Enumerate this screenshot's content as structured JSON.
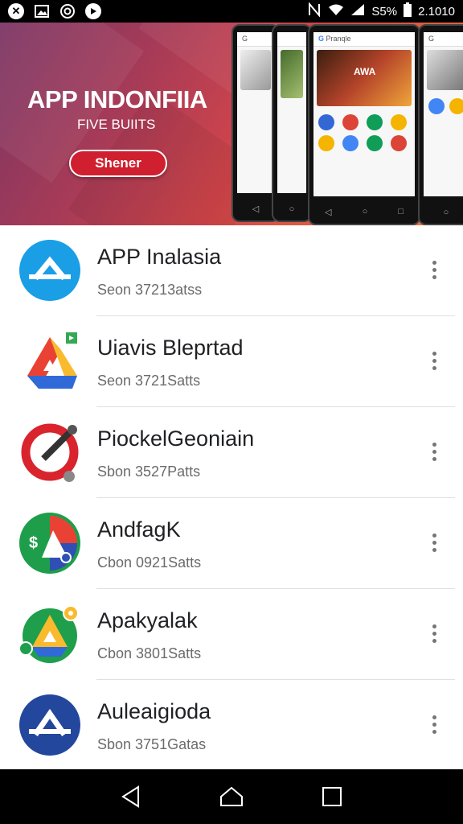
{
  "status_bar": {
    "left_icons": [
      "close-circle-icon",
      "image-icon",
      "sync-circle-icon",
      "play-circle-icon"
    ],
    "right_text": "S5%",
    "time": "2.1010"
  },
  "banner": {
    "title": "APP INDONFIIA",
    "subtitle": "FIVE BUIITS",
    "button_label": "Shener",
    "phone_search": "Pranqle",
    "phone_hero_text": "AWA"
  },
  "apps": [
    {
      "name": "APP Inalasia",
      "meta": "Seon 37213atss",
      "icon": "blue-a-icon"
    },
    {
      "name": "Uiavis Bleprtad",
      "meta": "Seon 3721Satts",
      "icon": "drive-triangle-icon"
    },
    {
      "name": "PiockelGeoniain",
      "meta": "Sbon 3527Patts",
      "icon": "red-ring-icon"
    },
    {
      "name": "AndfagK",
      "meta": "Cbon 0921Satts",
      "icon": "green-triangle-icon"
    },
    {
      "name": "Apakyalak",
      "meta": "Cbon 3801Satts",
      "icon": "drive-badge-icon"
    },
    {
      "name": "Auleaigioda",
      "meta": "Sbon 3751Gatas",
      "icon": "navy-a-icon"
    }
  ],
  "nav": [
    "back-icon",
    "home-icon",
    "recents-icon"
  ]
}
